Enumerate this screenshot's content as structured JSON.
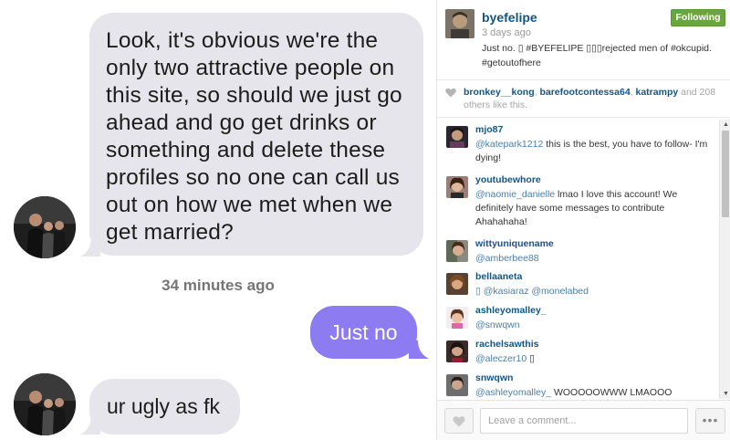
{
  "chat": {
    "messages": [
      {
        "direction": "incoming",
        "text": "Look, it's obvious we're the only two attractive people on this site, so should we just go ahead and go get drinks or something and delete these profiles so no one can call us out on how we met when we get married?"
      },
      {
        "direction": "outgoing",
        "text": "Just no"
      },
      {
        "direction": "incoming",
        "text": "ur ugly as fk"
      }
    ],
    "timestamp": "34 minutes ago",
    "colors": {
      "incoming_bubble": "#e6e5eb",
      "outgoing_bubble": "#8d7bf2",
      "timestamp": "#757575"
    }
  },
  "post": {
    "username": "byefelipe",
    "time_ago": "3 days ago",
    "caption": "Just no. ▯ #BYEFELIPE ▯▯▯rejected men of #okcupid. #getoutofhere",
    "follow_label": "Following",
    "likes": {
      "users": [
        "bronkey__kong",
        "barefootcontessa64",
        "katrampy"
      ],
      "sep1": ", ",
      "sep2": ", ",
      "others_text": " and 208 others like this."
    },
    "comments": [
      {
        "user": "mjo87",
        "mention": "@katepark1212",
        "text": " this is the best, you have to follow- I'm dying!"
      },
      {
        "user": "youtubewhore",
        "mention": "@naomie_danielle",
        "text": " lmao I love this account! We definitely have some messages to contribute Ahahahaha!"
      },
      {
        "user": "wittyuniquename",
        "mention": "@amberbee88",
        "text": ""
      },
      {
        "user": "bellaaneta",
        "mention": "▯ @kasiaraz @monelabed",
        "text": ""
      },
      {
        "user": "ashleyomalley_",
        "mention": "@snwqwn",
        "text": ""
      },
      {
        "user": "rachelsawthis",
        "mention": "@aleczer10",
        "text": " ▯"
      },
      {
        "user": "snwqwn",
        "mention": "@ashleyomalley_",
        "text": " WOOOOOWWW LMAOOO"
      }
    ],
    "comment_placeholder": "Leave a comment...",
    "more_label": "•••",
    "colors": {
      "username": "#125688",
      "follow": "#6ba53f"
    }
  },
  "icons": {
    "heart": "heart-icon",
    "scroll_up": "▲",
    "scroll_down": "▼"
  }
}
